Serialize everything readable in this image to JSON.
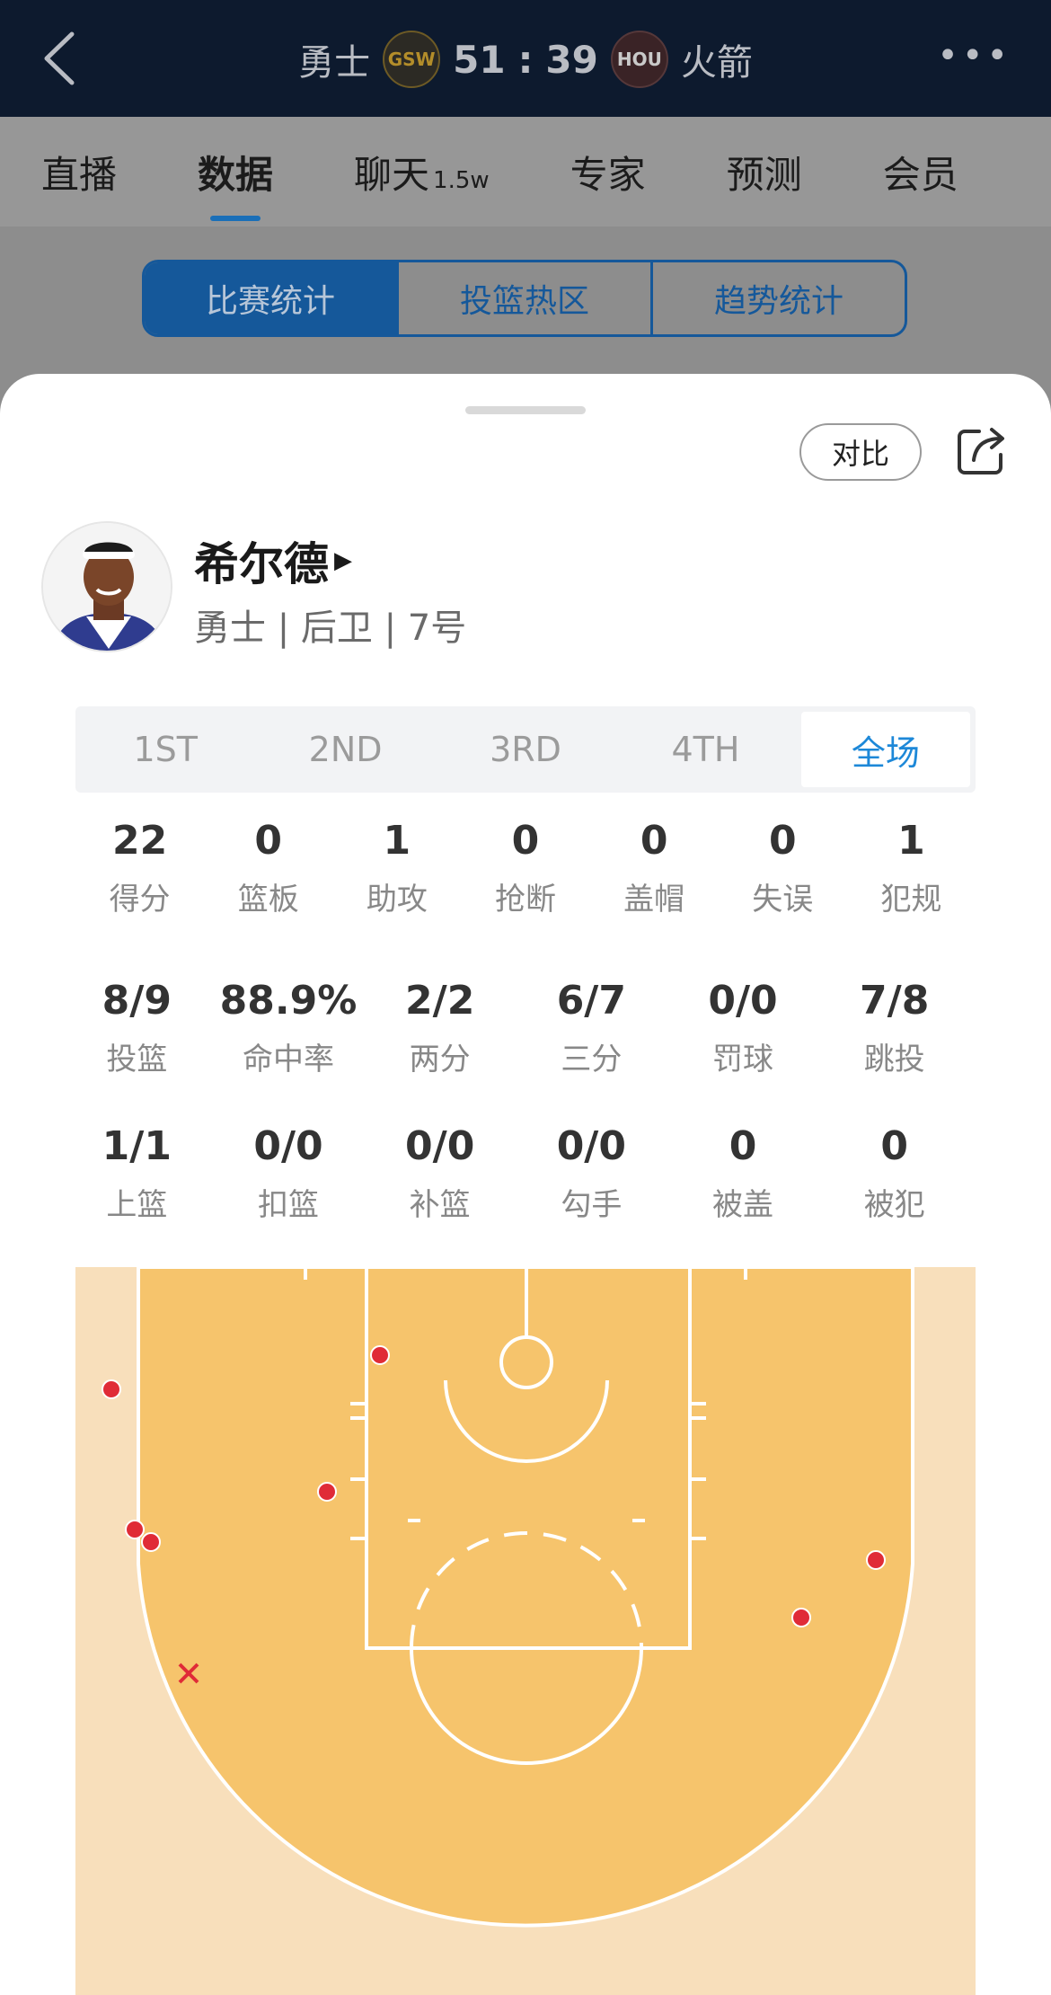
{
  "header": {
    "home_team": "勇士",
    "home_logo": "GSW",
    "home_score": "51",
    "separator": ":",
    "away_score": "39",
    "away_logo": "HOU",
    "away_team": "火箭"
  },
  "nav": {
    "tabs": [
      {
        "label": "直播"
      },
      {
        "label": "数据",
        "active": true
      },
      {
        "label": "聊天",
        "badge": "1.5w"
      },
      {
        "label": "专家"
      },
      {
        "label": "预测"
      },
      {
        "label": "会员"
      }
    ]
  },
  "segments": [
    "比赛统计",
    "投篮热区",
    "趋势统计"
  ],
  "sheet": {
    "compare_label": "对比",
    "player_name": "希尔德",
    "player_info": "勇士 | 后卫 | 7号"
  },
  "quarters": [
    "1ST",
    "2ND",
    "3RD",
    "4TH",
    "全场"
  ],
  "stats_basic": [
    {
      "value": "22",
      "label": "得分"
    },
    {
      "value": "0",
      "label": "篮板"
    },
    {
      "value": "1",
      "label": "助攻"
    },
    {
      "value": "0",
      "label": "抢断"
    },
    {
      "value": "0",
      "label": "盖帽"
    },
    {
      "value": "0",
      "label": "失误"
    },
    {
      "value": "1",
      "label": "犯规"
    }
  ],
  "stats_shooting": [
    {
      "value": "8/9",
      "label": "投篮"
    },
    {
      "value": "88.9%",
      "label": "命中率"
    },
    {
      "value": "2/2",
      "label": "两分"
    },
    {
      "value": "6/7",
      "label": "三分"
    },
    {
      "value": "0/0",
      "label": "罚球"
    },
    {
      "value": "7/8",
      "label": "跳投"
    }
  ],
  "stats_detail": [
    {
      "value": "1/1",
      "label": "上篮"
    },
    {
      "value": "0/0",
      "label": "扣篮"
    },
    {
      "value": "0/0",
      "label": "补篮"
    },
    {
      "value": "0/0",
      "label": "勾手"
    },
    {
      "value": "0",
      "label": "被盖"
    },
    {
      "value": "0",
      "label": "被犯"
    }
  ],
  "colors": {
    "header_bg": "#0d1a2e",
    "accent": "#1d88d8",
    "segment": "#15589a",
    "court_outer": "#f8dfbb",
    "court_inner": "#f6c46c",
    "made_shot": "#e02b37",
    "missed_shot": "#e02b37"
  }
}
